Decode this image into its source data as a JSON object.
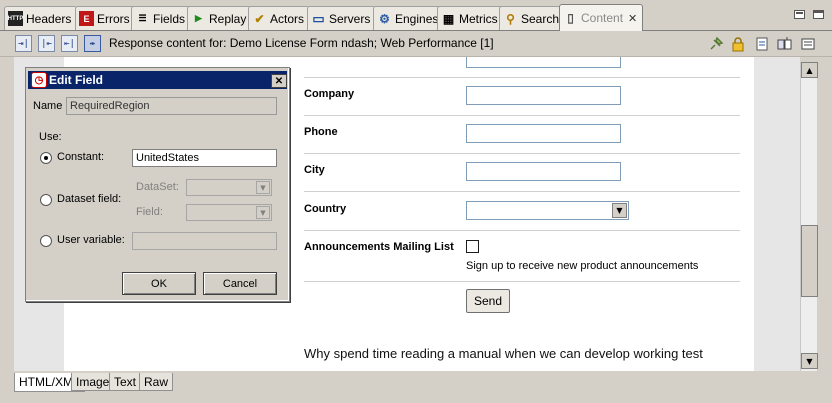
{
  "tabs": [
    {
      "label": "Headers",
      "icon": "http-icon",
      "icon_text": "HTTP"
    },
    {
      "label": "Errors",
      "icon": "errors-icon",
      "icon_text": "E"
    },
    {
      "label": "Fields",
      "icon": "fields-icon",
      "icon_text": "☰"
    },
    {
      "label": "Replay",
      "icon": "replay-icon",
      "icon_text": "▶"
    },
    {
      "label": "Actors",
      "icon": "actors-icon",
      "icon_text": "✔"
    },
    {
      "label": "Servers",
      "icon": "servers-icon",
      "icon_text": "▭"
    },
    {
      "label": "Engines",
      "icon": "engines-icon",
      "icon_text": "⚙"
    },
    {
      "label": "Metrics",
      "icon": "metrics-icon",
      "icon_text": "▦"
    },
    {
      "label": "Search",
      "icon": "search-icon",
      "icon_text": "⚲"
    },
    {
      "label": "Content",
      "icon": "content-icon",
      "icon_text": "▯"
    }
  ],
  "tab_close": "✕",
  "toolbar": {
    "title": "Response content for: Demo License Form ndash; Web Performance [1]",
    "buttons": [
      "⇥|",
      "|⇤",
      "⇤|",
      "⇹"
    ],
    "right_icons": [
      "pin-icon",
      "lock-icon",
      "document-icon",
      "columns-icon",
      "list-icon"
    ]
  },
  "form": {
    "company_label": "Company",
    "phone_label": "Phone",
    "city_label": "City",
    "country_label": "Country",
    "announcements_label": "Announcements Mailing List",
    "signup_text": "Sign up to receive new product announcements",
    "send_label": "Send",
    "body_text": "Why spend time reading a manual when we can develop working test"
  },
  "dialog": {
    "title": "Edit Field",
    "name_label": "Name",
    "name_value": "RequiredRegion",
    "use_label": "Use:",
    "constant_label": "Constant:",
    "constant_value": "UnitedStates",
    "dataset_field_label": "Dataset field:",
    "dataset_label": "DataSet:",
    "field_label": "Field:",
    "user_variable_label": "User variable:",
    "ok_label": "OK",
    "cancel_label": "Cancel",
    "selected": "constant"
  },
  "bottom_tabs": [
    "HTML/XML",
    "Image",
    "Text",
    "Raw"
  ]
}
